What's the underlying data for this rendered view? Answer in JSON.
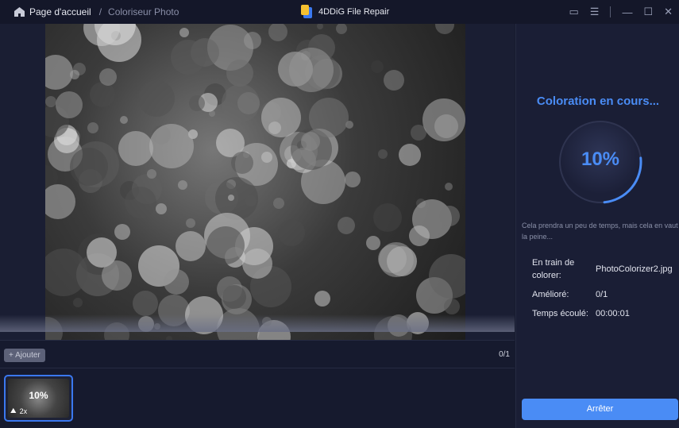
{
  "titlebar": {
    "home_label": "Page d'accueil",
    "separator": "/",
    "current": "Coloriseur Photo",
    "app_name": "4DDiG File Repair"
  },
  "toolbar": {
    "add_label": "+ Ajouter",
    "count": "0/1"
  },
  "thumbnail": {
    "progress": "10%",
    "scale": "2x"
  },
  "panel": {
    "status": "Coloration en cours...",
    "progress_percent": 10,
    "progress_label": "10%",
    "note": "Cela prendra un peu de temps, mais cela en vaut la peine...",
    "rows": [
      {
        "key": "En train de colorer:",
        "value": "PhotoColorizer2.jpg"
      },
      {
        "key": "Amélioré:",
        "value": "0/1"
      },
      {
        "key": "Temps écoulé:",
        "value": "00:00:01"
      }
    ],
    "stop_label": "Arrêter"
  },
  "colors": {
    "accent": "#4a8cf5",
    "background": "#161a2e"
  }
}
